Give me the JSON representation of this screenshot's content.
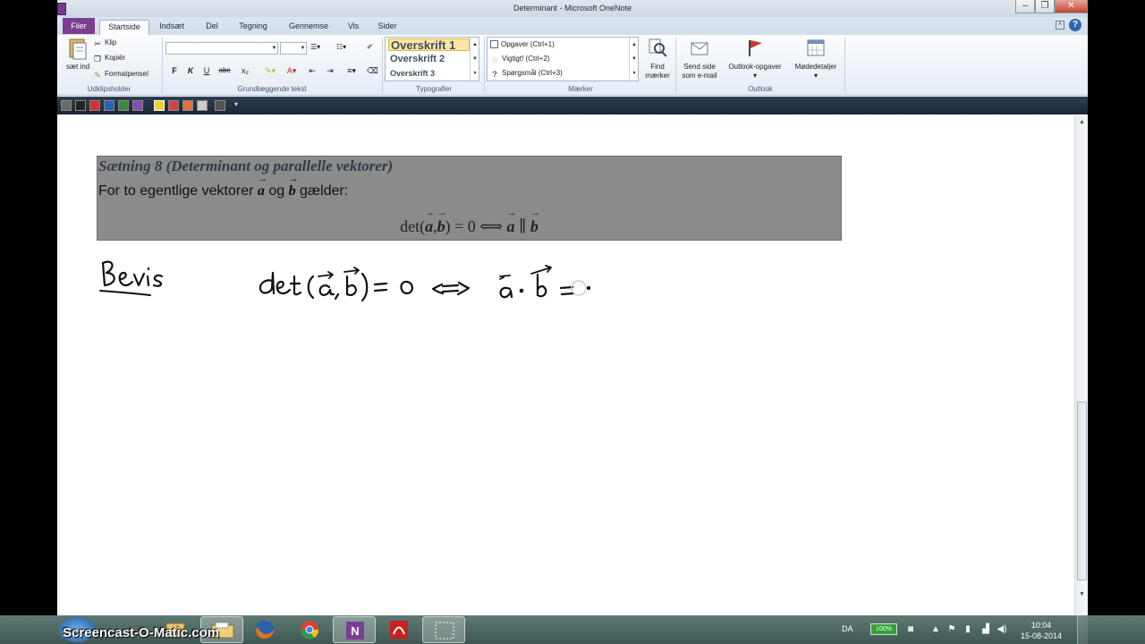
{
  "window": {
    "title": "Determinant - Microsoft OneNote"
  },
  "tabs": {
    "filer": "Filer",
    "startside": "Startside",
    "indsaet": "Indsæt",
    "del": "Del",
    "tegning": "Tegning",
    "gennemse": "Gennemse",
    "vis": "Vis",
    "sider": "Sider"
  },
  "ribbon": {
    "clipboard": {
      "paste_label": "sæt ind",
      "cut": "Klip",
      "copy": "Kopiér",
      "format_painter": "Formatpensel",
      "group_label": "Udklipsholder"
    },
    "basic_text": {
      "bold": "F",
      "italic": "K",
      "underline": "U",
      "strike": "abc",
      "subscript": "x₂",
      "group_label": "Grundlæggende tekst"
    },
    "styles": {
      "items": [
        "Overskrift 1",
        "Overskrift 2",
        "Overskrift 3"
      ],
      "group_label": "Typografier"
    },
    "tags": {
      "items": [
        "Opgaver (Ctrl+1)",
        "Vigtigt! (Ctrl+2)",
        "Spørgsmål (Ctrl+3)"
      ],
      "find_label_1": "Find",
      "find_label_2": "mærker",
      "group_label": "Mærker"
    },
    "outlook": {
      "send_1": "Send side",
      "send_2": "som e-mail",
      "tasks": "Outlook-opgaver",
      "meeting": "Mødedetaljer",
      "group_label": "Outlook"
    }
  },
  "note": {
    "theorem_title": "Sætning 8 (Determinant og parallelle vektorer)",
    "theorem_body_1": "For to egentlige vektorer ",
    "vec_a": "a",
    "theorem_body_2": " og ",
    "vec_b": "b",
    "theorem_body_3": " gælder:",
    "formula_det": "det(",
    "formula_comma": ",",
    "formula_rest": ") = 0 ⟺ ",
    "formula_parallel": " ∥ "
  },
  "taskbar": {
    "watermark": "Screencast-O-Matic.com",
    "language": "DA",
    "battery": "100%",
    "time": "10:04",
    "date": "15-08-2014"
  },
  "colors": {
    "filer_tab": "#7b3e92",
    "theorem_bg": "#8b8b8b",
    "ink": "#111111"
  }
}
